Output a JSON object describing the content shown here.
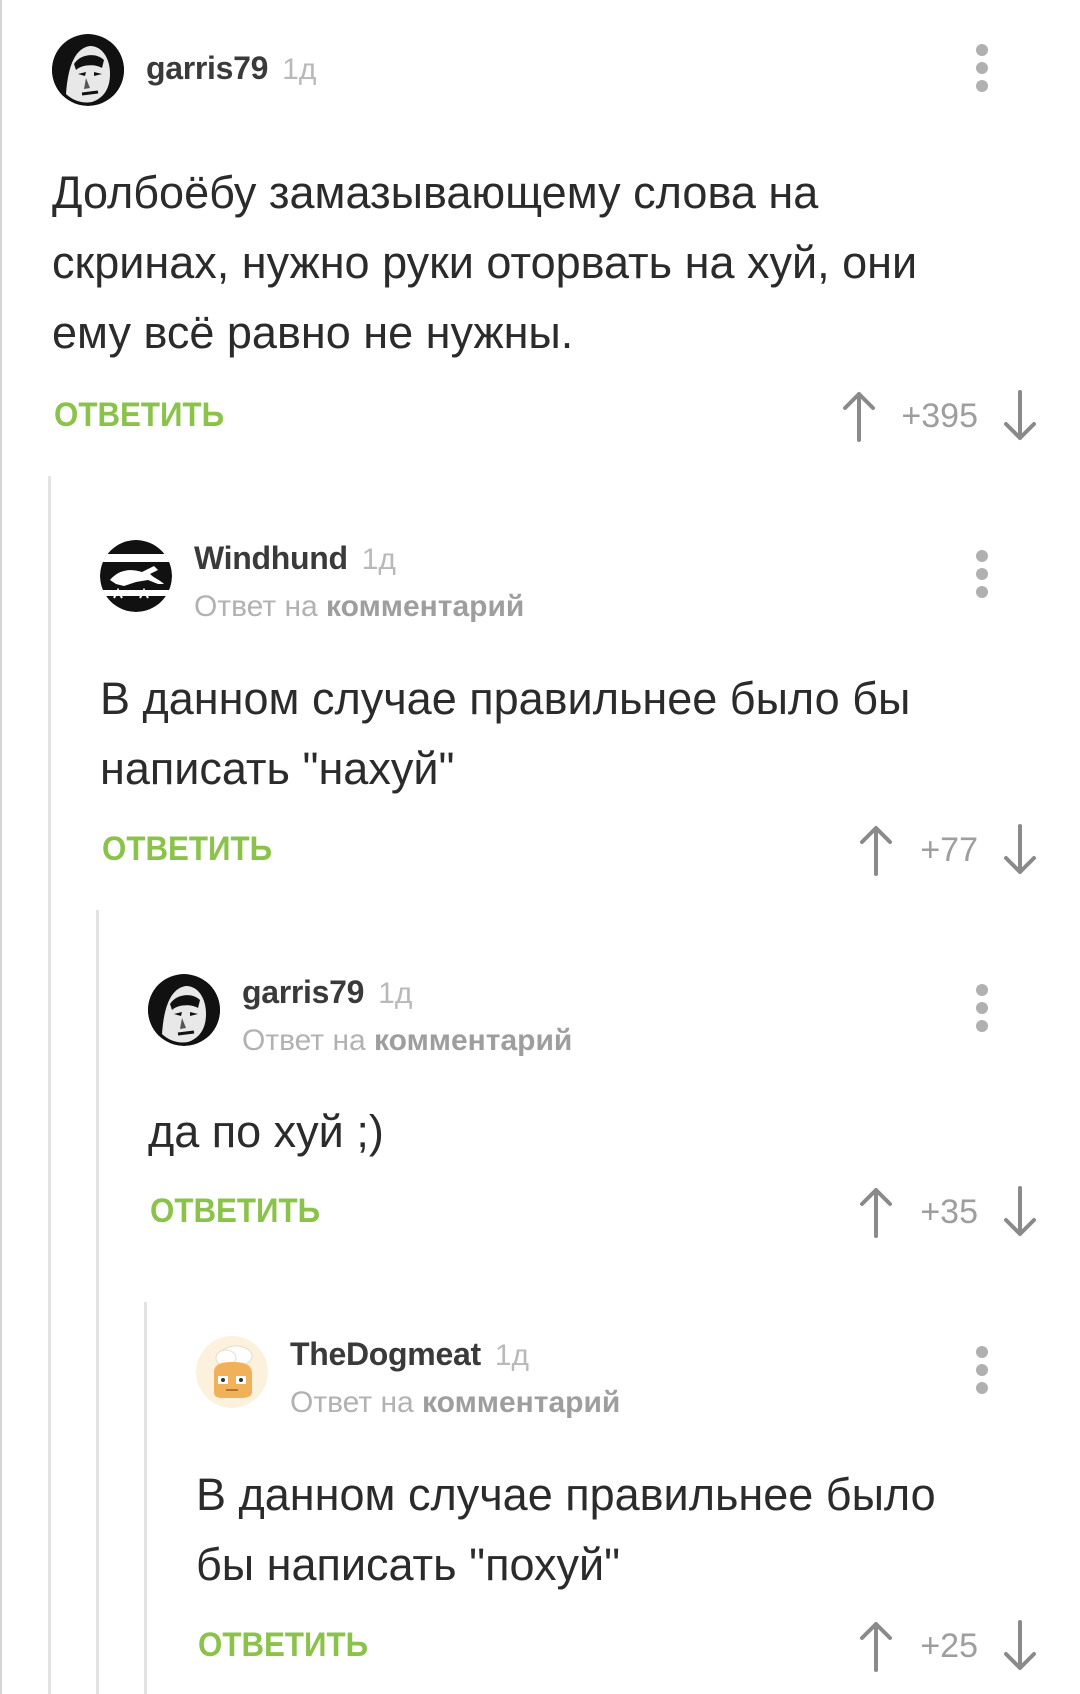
{
  "comments": [
    {
      "username": "garris79",
      "time": "1д",
      "reply_prefix": "",
      "reply_link": "",
      "text_lines": [
        "Долбоёбу замазывающему слова на",
        "скринах, нужно руки оторвать на хуй, они",
        "ему всё равно не нужны."
      ],
      "reply_label": "ОТВЕТИТЬ",
      "score": "+395"
    },
    {
      "username": "Windhund",
      "time": "1д",
      "reply_prefix": "Ответ на",
      "reply_link": "комментарий",
      "text_lines": [
        "В данном случае правильнее было бы",
        "написать \"нахуй\""
      ],
      "reply_label": "ОТВЕТИТЬ",
      "score": "+77"
    },
    {
      "username": "garris79",
      "time": "1д",
      "reply_prefix": "Ответ на",
      "reply_link": "комментарий",
      "text_lines": [
        "да по хуй ;)"
      ],
      "reply_label": "ОТВЕТИТЬ",
      "score": "+35"
    },
    {
      "username": "TheDogmeat",
      "time": "1д",
      "reply_prefix": "Ответ на",
      "reply_link": "комментарий",
      "text_lines": [
        "В данном случае правильнее было",
        "бы написать \"похуй\""
      ],
      "reply_label": "ОТВЕТИТЬ",
      "score": "+25"
    }
  ],
  "icons": {
    "upvote": "arrow-up-icon",
    "downvote": "arrow-down-icon",
    "menu": "more-vertical-icon"
  },
  "colors": {
    "accent_green": "#8bc34a",
    "muted_gray": "#9e9e9e",
    "text": "#2b2b2b"
  }
}
